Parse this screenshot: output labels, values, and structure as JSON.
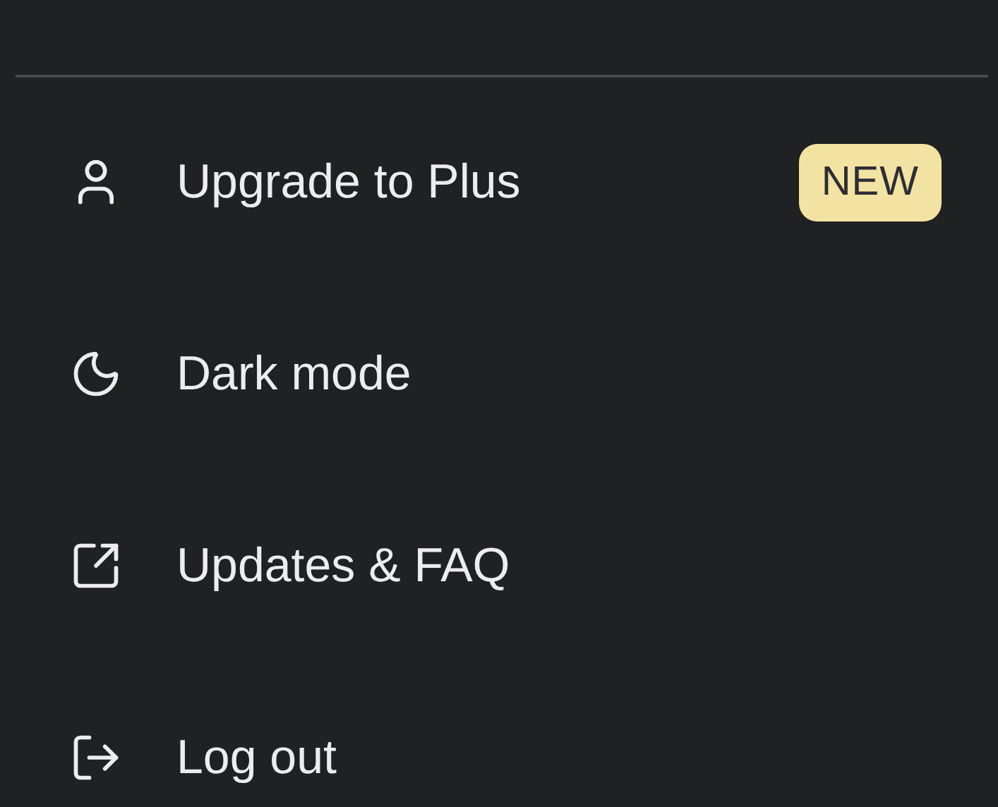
{
  "menu": {
    "items": [
      {
        "kind": "user",
        "label": "Upgrade to Plus",
        "badge": "NEW"
      },
      {
        "kind": "moon",
        "label": "Dark mode"
      },
      {
        "kind": "external",
        "label": "Updates & FAQ"
      },
      {
        "kind": "logout",
        "label": "Log out"
      }
    ]
  }
}
